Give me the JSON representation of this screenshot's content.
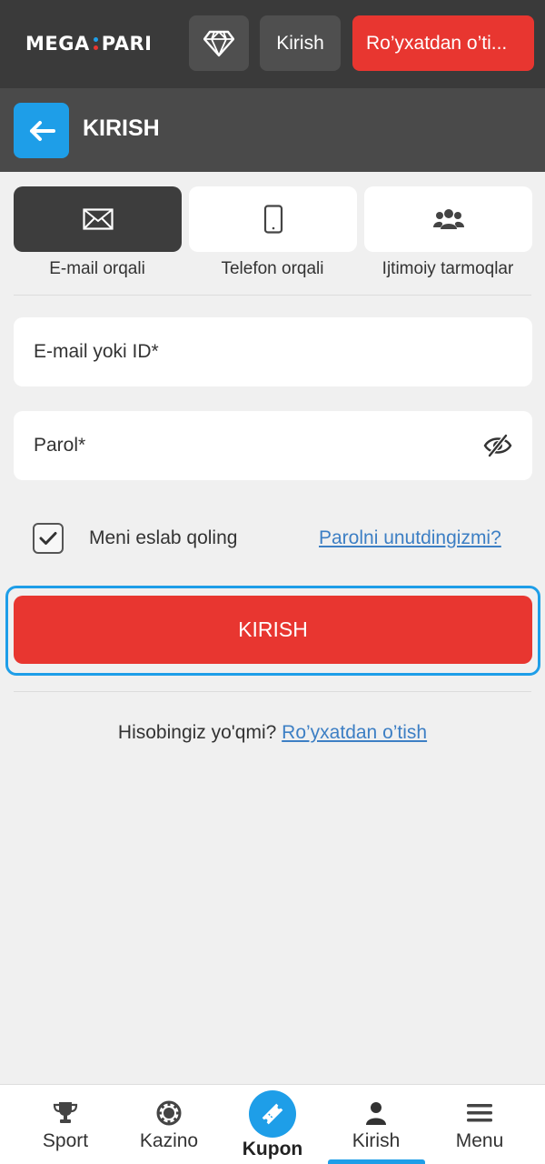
{
  "topbar": {
    "logo_left": "MEGA",
    "logo_right": "PARI",
    "gem_icon": "diamond-icon",
    "login_label": "Kirish",
    "register_label": "Ro’yxatdan o’ti...",
    "colors": {
      "bg": "#3a3a3a",
      "button": "#4f4f4f",
      "register": "#e83630"
    }
  },
  "header": {
    "back_icon": "arrow-left-icon",
    "title": "KIRISH"
  },
  "methods": [
    {
      "label": "E-mail orqali",
      "icon": "envelope-icon",
      "active": true
    },
    {
      "label": "Telefon orqali",
      "icon": "phone-icon",
      "active": false
    },
    {
      "label": "Ijtimoiy tarmoqlar",
      "icon": "users-icon",
      "active": false
    }
  ],
  "form": {
    "email_placeholder": "E-mail yoki ID*",
    "email_value": "",
    "password_placeholder": "Parol*",
    "password_value": "",
    "remember_label": "Meni eslab qoling",
    "remember_checked": true,
    "forgot_label": "Parolni unutdingizmi?",
    "submit_label": "KIRISH"
  },
  "register_prompt": {
    "text": "Hisobingiz yo'qmi? ",
    "link": "Ro’yxatdan o’tish"
  },
  "bottom_nav": [
    {
      "label": "Sport",
      "icon": "trophy-icon"
    },
    {
      "label": "Kazino",
      "icon": "casino-chip-icon"
    },
    {
      "label": "Kupon",
      "icon": "ticket-icon"
    },
    {
      "label": "Kirish",
      "icon": "user-icon",
      "active": true
    },
    {
      "label": "Menu",
      "icon": "hamburger-icon"
    }
  ],
  "accent_color": "#1e9ee8"
}
